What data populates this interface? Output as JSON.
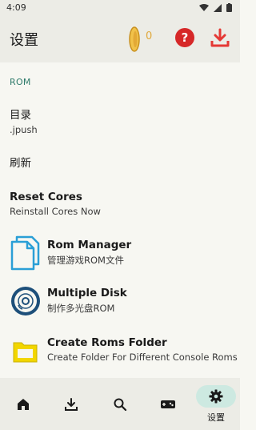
{
  "status_bar": {
    "time": "4:09"
  },
  "header": {
    "title": "设置",
    "coin_count": "0"
  },
  "section": {
    "label": "ROM"
  },
  "settings": {
    "directory": {
      "title": "目录",
      "value": ".jpush"
    },
    "refresh": {
      "title": "刷新"
    },
    "reset_cores": {
      "title": "Reset Cores",
      "subtitle": "Reinstall Cores Now"
    },
    "rom_manager": {
      "title": "Rom Manager",
      "subtitle": "管理游戏ROM文件"
    },
    "multiple_disk": {
      "title": "Multiple Disk",
      "subtitle": "制作多光盘ROM"
    },
    "create_roms_folder": {
      "title": "Create Roms Folder",
      "subtitle": "Create Folder For Different Console Roms"
    }
  },
  "bottom_nav": {
    "items": [
      {
        "icon": "home-icon"
      },
      {
        "icon": "download-icon"
      },
      {
        "icon": "search-icon"
      },
      {
        "icon": "gamepad-icon"
      },
      {
        "icon": "gear-icon",
        "label": "设置",
        "active": true
      }
    ]
  },
  "colors": {
    "accent": "#2d7a6a",
    "coin": "#e0a93c",
    "help": "#d62828",
    "download": "#e53935",
    "active_pill": "#cde9e1"
  }
}
